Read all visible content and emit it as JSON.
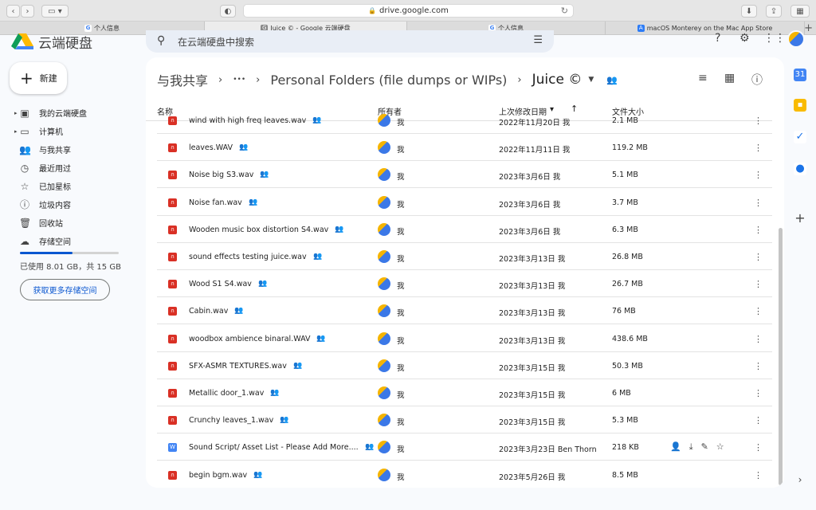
{
  "browser": {
    "url": "drive.google.com",
    "tabs": [
      {
        "label": "个人信息",
        "favicon": "google-icon"
      },
      {
        "label": "Juice ©  - Google 云端硬盘",
        "favicon": "drive-icon"
      },
      {
        "label": "个人信息",
        "favicon": "google-icon"
      },
      {
        "label": "macOS Monterey on the Mac App Store",
        "favicon": "app-store-icon"
      }
    ]
  },
  "header": {
    "brand": "云端硬盘",
    "search_placeholder": "在云端硬盘中搜索"
  },
  "sidebar": {
    "new_label": "新建",
    "items": [
      {
        "label": "我的云端硬盘",
        "icon": "my-drive-icon"
      },
      {
        "label": "计算机",
        "icon": "computer-icon"
      },
      {
        "label": "与我共享",
        "icon": "shared-icon"
      },
      {
        "label": "最近用过",
        "icon": "clock-icon"
      },
      {
        "label": "已加星标",
        "icon": "star-icon"
      },
      {
        "label": "垃圾内容",
        "icon": "spam-icon"
      },
      {
        "label": "回收站",
        "icon": "trash-icon"
      },
      {
        "label": "存储空间",
        "icon": "cloud-icon"
      }
    ],
    "storage_text": "已使用 8.01 GB，共 15 GB",
    "storage_fraction": 0.534,
    "more_storage_label": "获取更多存储空间"
  },
  "breadcrumb": {
    "root": "与我共享",
    "ellipsis": "•••",
    "parent": "Personal Folders (file dumps or WIPs)",
    "current": "Juice ©"
  },
  "columns": {
    "name": "名称",
    "owner": "所有者",
    "modified": "上次修改日期",
    "size": "文件大小"
  },
  "files": [
    {
      "name": "wind with high freq leaves.wav",
      "owner": "我",
      "modified": "2022年11月20日 我",
      "size": "2.1 MB",
      "type": "audio"
    },
    {
      "name": "leaves.WAV",
      "owner": "我",
      "modified": "2022年11月11日 我",
      "size": "119.2 MB",
      "type": "audio"
    },
    {
      "name": "Noise big S3.wav",
      "owner": "我",
      "modified": "2023年3月6日 我",
      "size": "5.1 MB",
      "type": "audio"
    },
    {
      "name": "Noise fan.wav",
      "owner": "我",
      "modified": "2023年3月6日 我",
      "size": "3.7 MB",
      "type": "audio"
    },
    {
      "name": "Wooden music box distortion S4.wav",
      "owner": "我",
      "modified": "2023年3月6日 我",
      "size": "6.3 MB",
      "type": "audio"
    },
    {
      "name": "sound effects testing juice.wav",
      "owner": "我",
      "modified": "2023年3月13日 我",
      "size": "26.8 MB",
      "type": "audio"
    },
    {
      "name": "Wood S1 S4.wav",
      "owner": "我",
      "modified": "2023年3月13日 我",
      "size": "26.7 MB",
      "type": "audio"
    },
    {
      "name": "Cabin.wav",
      "owner": "我",
      "modified": "2023年3月13日 我",
      "size": "76 MB",
      "type": "audio"
    },
    {
      "name": "woodbox ambience binaral.WAV",
      "owner": "我",
      "modified": "2023年3月13日 我",
      "size": "438.6 MB",
      "type": "audio"
    },
    {
      "name": "SFX-ASMR TEXTURES.wav",
      "owner": "我",
      "modified": "2023年3月15日 我",
      "size": "50.3 MB",
      "type": "audio"
    },
    {
      "name": "Metallic door_1.wav",
      "owner": "我",
      "modified": "2023年3月15日 我",
      "size": "6 MB",
      "type": "audio"
    },
    {
      "name": "Crunchy leaves_1.wav",
      "owner": "我",
      "modified": "2023年3月15日 我",
      "size": "5.3 MB",
      "type": "audio"
    },
    {
      "name": "Sound Script/ Asset List - Please Add More....",
      "owner": "我",
      "modified": "2023年3月23日 Ben Thorn",
      "size": "218 KB",
      "type": "doc",
      "hovered": true
    },
    {
      "name": "begin bgm.wav",
      "owner": "我",
      "modified": "2023年5月26日 我",
      "size": "8.5 MB",
      "type": "audio"
    }
  ],
  "colors": {
    "accent": "#0b57d0",
    "audio_icon": "#d93025",
    "doc_icon": "#4285f4",
    "surface": "#f8fafd"
  }
}
